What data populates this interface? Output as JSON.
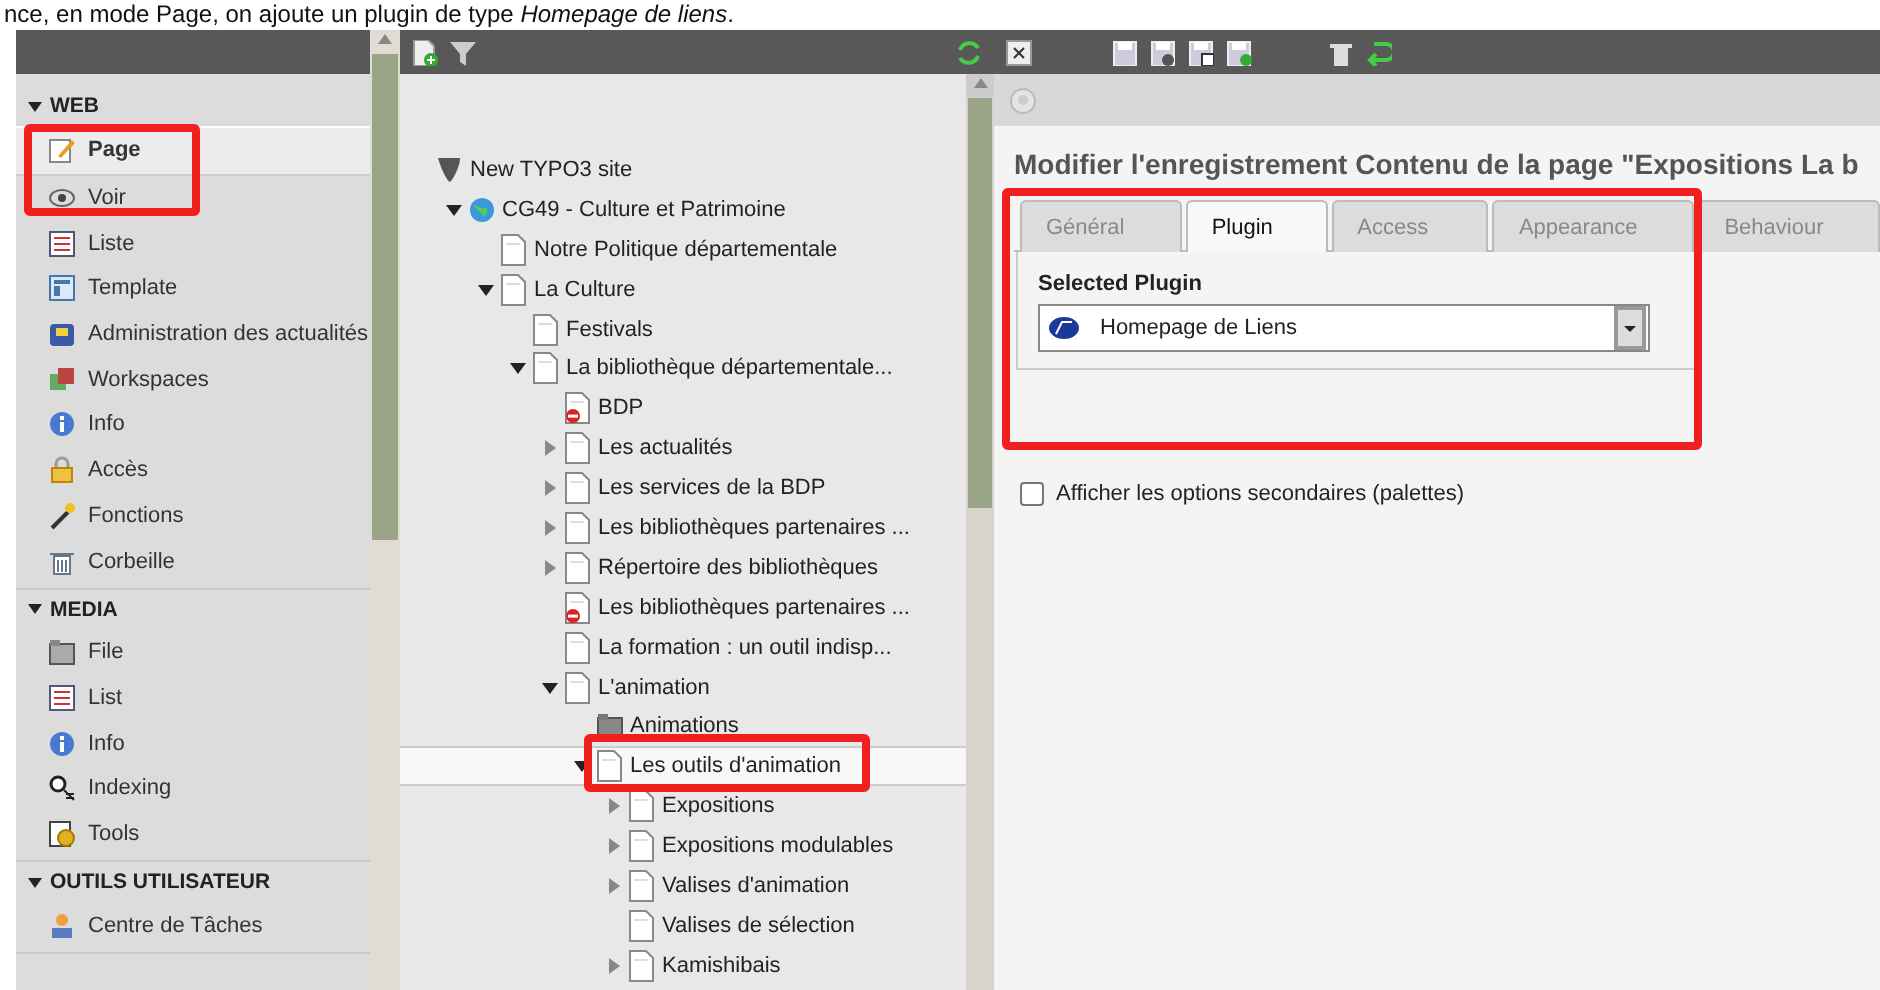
{
  "caption": "nce, en mode Page, on ajoute un plugin de type *Homepage de liens*.",
  "module_menu": {
    "sections": [
      {
        "title": "WEB",
        "expanded": true,
        "items": [
          {
            "label": "Page",
            "selected": true
          },
          {
            "label": "Voir",
            "selected": false
          },
          {
            "label": "Liste",
            "selected": false
          },
          {
            "label": "Template",
            "selected": false
          },
          {
            "label": "Administration des actualités",
            "selected": false
          },
          {
            "label": "Workspaces",
            "selected": false
          },
          {
            "label": "Info",
            "selected": false
          },
          {
            "label": "Accès",
            "selected": false
          },
          {
            "label": "Fonctions",
            "selected": false
          },
          {
            "label": "Corbeille",
            "selected": false
          }
        ]
      },
      {
        "title": "MEDIA",
        "expanded": true,
        "items": [
          {
            "label": "File",
            "selected": false
          },
          {
            "label": "List",
            "selected": false
          },
          {
            "label": "Info",
            "selected": false
          },
          {
            "label": "Indexing",
            "selected": false
          },
          {
            "label": "Tools",
            "selected": false
          }
        ]
      },
      {
        "title": "OUTILS UTILISATEUR",
        "expanded": true,
        "items": [
          {
            "label": "Centre de Tâches",
            "selected": false
          }
        ]
      }
    ]
  },
  "page_tree": {
    "root": {
      "label": "New TYPO3 site",
      "kind": "site",
      "selected": false,
      "children": [
        {
          "label": "CG49 - Culture et Patrimoine",
          "kind": "globe",
          "expanded": true,
          "selected": false,
          "children": [
            {
              "label": "Notre Politique départementale",
              "kind": "page",
              "selected": false
            },
            {
              "label": "La Culture",
              "kind": "page",
              "expanded": true,
              "selected": false,
              "children": [
                {
                  "label": "Festivals",
                  "kind": "page",
                  "selected": false
                },
                {
                  "label": "La bibliothèque départementale...",
                  "kind": "page",
                  "expanded": true,
                  "selected": false,
                  "children": [
                    {
                      "label": "BDP",
                      "kind": "hidden-page",
                      "selected": false
                    },
                    {
                      "label": "Les actualités",
                      "kind": "page",
                      "expanded": false,
                      "selected": false
                    },
                    {
                      "label": "Les services de la BDP",
                      "kind": "page",
                      "expanded": false,
                      "selected": false
                    },
                    {
                      "label": "Les bibliothèques partenaires ...",
                      "kind": "page",
                      "expanded": false,
                      "selected": false
                    },
                    {
                      "label": "Répertoire des bibliothèques",
                      "kind": "page",
                      "expanded": false,
                      "selected": false
                    },
                    {
                      "label": "Les bibliothèques partenaires ...",
                      "kind": "hidden-page",
                      "selected": false
                    },
                    {
                      "label": "La formation : un outil indisp...",
                      "kind": "page",
                      "selected": false
                    },
                    {
                      "label": "L'animation",
                      "kind": "page",
                      "expanded": true,
                      "selected": false,
                      "children": [
                        {
                          "label": "Animations",
                          "kind": "folder",
                          "selected": false
                        },
                        {
                          "label": "Les outils d'animation",
                          "kind": "page",
                          "expanded": true,
                          "selected": true,
                          "children": [
                            {
                              "label": "Expositions",
                              "kind": "page",
                              "expanded": false,
                              "selected": false
                            },
                            {
                              "label": "Expositions modulables",
                              "kind": "page",
                              "expanded": false,
                              "selected": false
                            },
                            {
                              "label": "Valises d'animation",
                              "kind": "page",
                              "expanded": false,
                              "selected": false
                            },
                            {
                              "label": "Valises de sélection",
                              "kind": "page",
                              "selected": false
                            },
                            {
                              "label": "Kamishibais",
                              "kind": "page",
                              "expanded": false,
                              "selected": false
                            }
                          ]
                        }
                      ]
                    }
                  ]
                }
              ]
            }
          ]
        }
      ]
    }
  },
  "editor": {
    "title": "Modifier l'enregistrement Contenu de la page \"Expositions La b",
    "tabs": [
      {
        "label": "Général",
        "selected": false
      },
      {
        "label": "Plugin",
        "selected": true
      },
      {
        "label": "Access",
        "selected": false
      },
      {
        "label": "Appearance",
        "selected": false
      },
      {
        "label": "Behaviour",
        "selected": false
      }
    ],
    "field": {
      "label": "Selected Plugin",
      "value": "Homepage de Liens"
    },
    "palettes": {
      "label": "Afficher les options secondaires (palettes)",
      "checked": false
    }
  }
}
